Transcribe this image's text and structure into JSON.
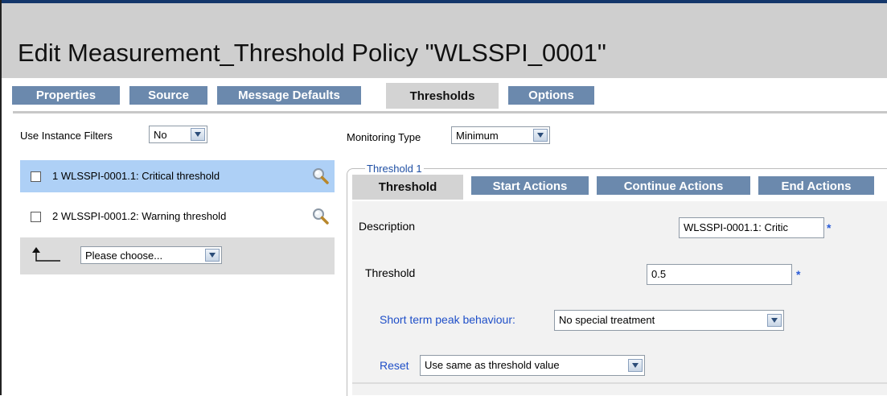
{
  "page": {
    "title": "Edit Measurement_Threshold Policy \"WLSSPI_0001\""
  },
  "tabs": [
    {
      "label": "Properties",
      "active": false
    },
    {
      "label": "Source",
      "active": false
    },
    {
      "label": "Message Defaults",
      "active": false
    },
    {
      "label": "Thresholds",
      "active": true
    },
    {
      "label": "Options",
      "active": false
    }
  ],
  "filters": {
    "instance_label": "Use Instance Filters",
    "instance_value": "No",
    "monitoring_label": "Monitoring Type",
    "monitoring_value": "Minimum"
  },
  "threshold_list": [
    {
      "label": "1 WLSSPI-0001.1: Critical threshold",
      "selected": true,
      "checked": false
    },
    {
      "label": "2 WLSSPI-0001.2: Warning threshold",
      "selected": false,
      "checked": false
    }
  ],
  "action_select": {
    "value": "Please choose..."
  },
  "threshold_panel": {
    "legend": "Threshold 1",
    "subtabs": [
      {
        "label": "Threshold",
        "active": true
      },
      {
        "label": "Start Actions",
        "active": false
      },
      {
        "label": "Continue Actions",
        "active": false
      },
      {
        "label": "End Actions",
        "active": false
      }
    ],
    "description_label": "Description",
    "description_value": "WLSSPI-0001.1: Critic",
    "threshold_label": "Threshold",
    "threshold_value": "0.5",
    "required_marker": "*",
    "peak_label": "Short term peak behaviour:",
    "peak_value": "No special treatment",
    "reset_label": "Reset",
    "reset_value": "Use same as threshold value"
  },
  "colors": {
    "tab_bg": "#6b89ad",
    "tab_active_bg": "#d3d3d3",
    "selected_row": "#aed0f6",
    "link_blue": "#1f4fc8",
    "header_bg": "#cfcfcf"
  }
}
